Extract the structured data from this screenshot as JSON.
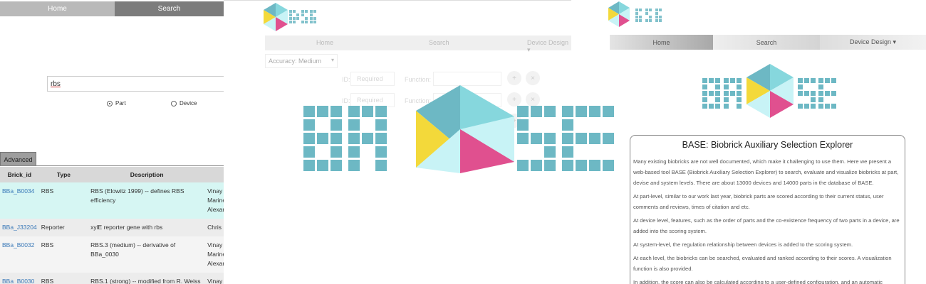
{
  "left_panel": {
    "nav": {
      "home": "Home",
      "search": "Search"
    },
    "search_value": "rbs",
    "radio": {
      "part": "Part",
      "device": "Device",
      "selected": "part"
    },
    "advanced_tab": "Advanced",
    "table": {
      "headers": [
        "Brick_id",
        "Type",
        "Description"
      ],
      "rows": [
        {
          "id": "BBa_B0034",
          "type": "RBS",
          "desc1": "RBS (Elowitz 1999) -- defines RBS",
          "desc2": "efficiency",
          "col4": [
            "Vinay S",
            "Marine",
            "Alexan"
          ]
        },
        {
          "id": "BBa_J33204",
          "type": "Reporter",
          "desc1": "xylE reporter gene with rbs",
          "desc2": "",
          "col4": [
            "Chris F"
          ]
        },
        {
          "id": "BBa_B0032",
          "type": "RBS",
          "desc1": "RBS.3 (medium) -- derivative of",
          "desc2": "BBa_0030",
          "col4": [
            "Vinay S",
            "Marine",
            "Alexan"
          ]
        },
        {
          "id": "BBa_B0030",
          "type": "RBS",
          "desc1": "RBS.1 (strong) -- modified from R. Weiss",
          "desc2": "",
          "col4": [
            "Vinay S"
          ]
        }
      ]
    }
  },
  "middle_panel": {
    "nav": {
      "home": "Home",
      "search": "Search",
      "device": "Device Design ▾"
    },
    "accuracy": {
      "label": "Accuracy:",
      "value": "Medium"
    },
    "rows": [
      {
        "id_label": "ID:",
        "id_placeholder": "Required",
        "func_label": "Function:"
      },
      {
        "id_label": "ID:",
        "id_placeholder": "Required",
        "func_label": "Function:"
      }
    ]
  },
  "right_panel": {
    "nav": {
      "home": "Home",
      "search": "Search",
      "device": "Device Design ▾"
    },
    "title": "BASE: Biobrick Auxiliary Selection Explorer",
    "paragraphs": [
      "Many existing biobricks are not well documented, which make it challenging to use them. Here we present a web-based tool BASE (Biobrick Auxiliary Selection Explorer) to search, evaluate and visualize biobricks at part, devise and system levels. There are about 13000 devices and 14000 parts in the database of BASE.",
      "At part-level, similar to our work last year, biobrick parts are scored according to their current status, user comments and reviews, times of citation and etc.",
      "At device level, features, such as the order of parts and the co-existence frequency of two parts in a device, are added into the scoring system.",
      "At system-level, the regulation relationship between devices is added to the scoring system.",
      "At each level, the biobricks can be searched, evaluated and ranked according to their scores. A visualization function is also provided.",
      "In addition, the score can also be calculated according to a user-defined configuration, and an automatic"
    ]
  },
  "logo": {
    "colors": {
      "teal": "#6db8c4",
      "light_teal": "#86d7dd",
      "yellow": "#f3d93a",
      "pink": "#e0508f",
      "pale_cyan": "#c8f3f6"
    }
  }
}
